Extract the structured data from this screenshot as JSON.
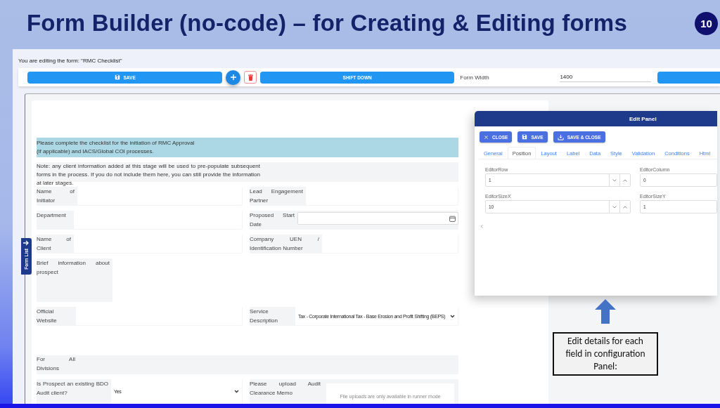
{
  "slide": {
    "title": "Form Builder (no-code) – for Creating & Editing forms",
    "page_number": "10"
  },
  "editor": {
    "editing_label": "You are editing the form: \"RMC Checklist\"",
    "save_button": "SAVE",
    "shift_down_button": "SHIFT DOWN",
    "form_width_label": "Form Width",
    "form_width_value": "1400"
  },
  "form_list_tab": "Form List",
  "form": {
    "rows": [
      {
        "kind": "banner",
        "text": "Please complete the checklist for the initiation of RMC Approval\n(if applicable) and IACS/Global COI processes."
      },
      {
        "kind": "note",
        "text": "Note: any client information added at this stage will be used to pre-populate subsequent forms in the process. If you do not include them here, you can still provide the information at later stages."
      },
      {
        "kind": "pair",
        "fields": [
          {
            "label": "Name of Initiator",
            "kind": "text"
          },
          {
            "label": "Lead Engagement Partner",
            "kind": "text"
          }
        ]
      },
      {
        "kind": "pair",
        "fields": [
          {
            "label": "Department",
            "kind": "text"
          },
          {
            "label": "Proposed Start Date",
            "kind": "date"
          }
        ]
      },
      {
        "kind": "pair",
        "fields": [
          {
            "label": "Name of Client",
            "kind": "text"
          },
          {
            "label": "Company UEN / Identification Number",
            "kind": "text"
          }
        ]
      },
      {
        "kind": "wide",
        "fields": [
          {
            "label": "Brief information about prospect",
            "kind": "textarea"
          }
        ]
      },
      {
        "kind": "pair",
        "fields": [
          {
            "label": "Official Website",
            "kind": "text"
          },
          {
            "label": "Service Description",
            "kind": "select",
            "value": "Tax - Corporate International Tax - Base Erosion and Profit Shifting (BEPS)"
          }
        ]
      },
      {
        "kind": "section",
        "label": "For All Divisions"
      },
      {
        "kind": "pair",
        "fields": [
          {
            "label": "Is Prospect an existing BDO Audit client?",
            "kind": "select",
            "value": "Yes"
          },
          {
            "label": "Please upload Audit Clearance Memo",
            "kind": "upload",
            "message": "File uploads are only available in runner mode"
          }
        ]
      }
    ]
  },
  "edit_panel": {
    "title": "Edit Panel",
    "buttons": [
      {
        "label": "CLOSE",
        "kind": "close"
      },
      {
        "label": "SAVE",
        "kind": "save"
      },
      {
        "label": "SAVE & CLOSE",
        "kind": "save_close"
      }
    ],
    "tabs": [
      {
        "label": "General",
        "selected": false
      },
      {
        "label": "Position",
        "selected": true
      },
      {
        "label": "Layout",
        "selected": false
      },
      {
        "label": "Label",
        "selected": false
      },
      {
        "label": "Data",
        "selected": false
      },
      {
        "label": "Style",
        "selected": false
      },
      {
        "label": "Validation",
        "selected": false
      },
      {
        "label": "Conditions",
        "selected": false
      },
      {
        "label": "Html",
        "selected": false
      }
    ],
    "fields": [
      {
        "label": "EditorRow",
        "value": "1",
        "kind": "spinner"
      },
      {
        "label": "EditorColumn",
        "value": "0",
        "kind": "text"
      },
      {
        "label": "EditorSizeX",
        "value": "10",
        "kind": "spinner"
      },
      {
        "label": "EditorSizeY",
        "value": "1",
        "kind": "text"
      }
    ]
  },
  "callout": "Edit details for each field in configuration Panel:"
}
